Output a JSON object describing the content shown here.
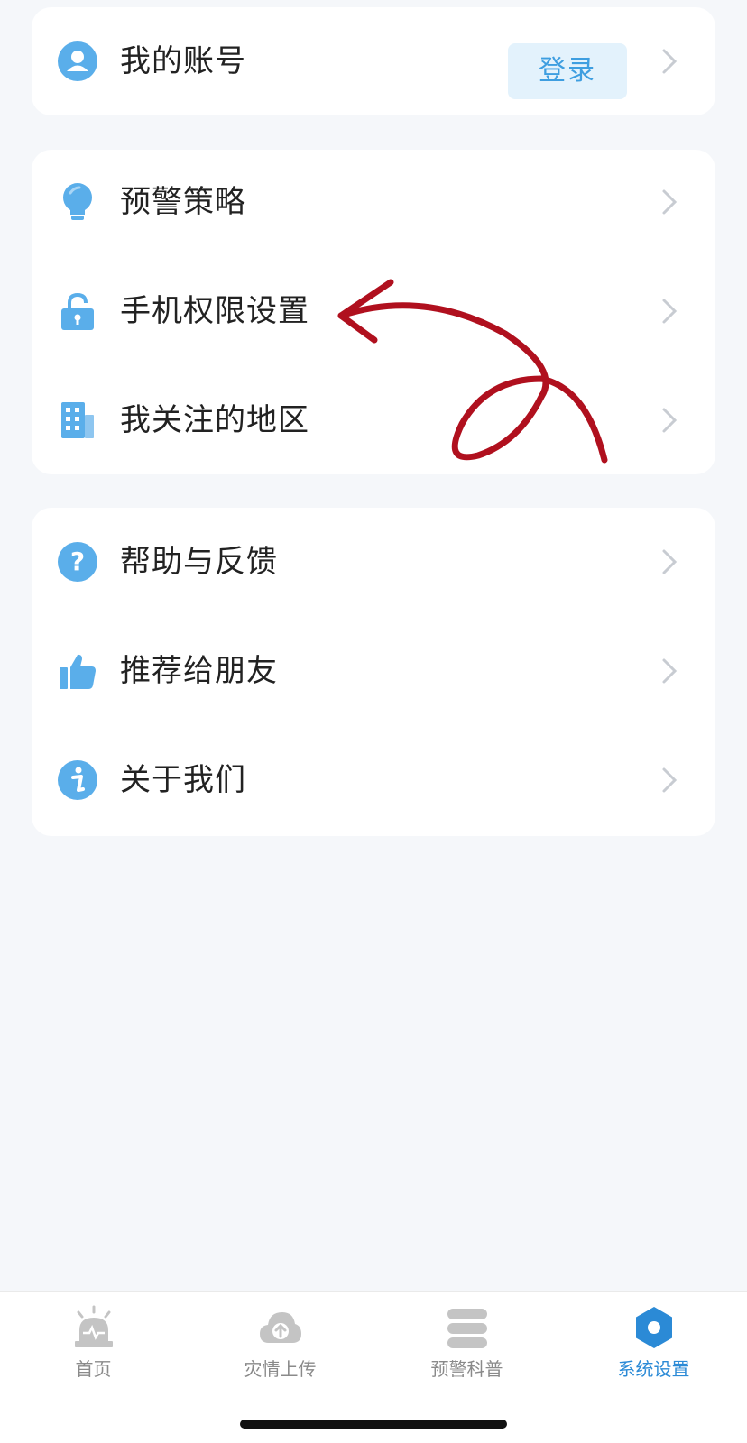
{
  "account_card": {
    "account_label": "我的账号",
    "login_button": "登录"
  },
  "settings_card": {
    "items": [
      {
        "label": "预警策略",
        "icon": "lightbulb-icon"
      },
      {
        "label": "手机权限设置",
        "icon": "lock-icon"
      },
      {
        "label": "我关注的地区",
        "icon": "building-icon"
      }
    ]
  },
  "support_card": {
    "items": [
      {
        "label": "帮助与反馈",
        "icon": "help-icon"
      },
      {
        "label": "推荐给朋友",
        "icon": "thumbs-up-icon"
      },
      {
        "label": "关于我们",
        "icon": "info-icon"
      }
    ]
  },
  "tabbar": {
    "tabs": [
      {
        "label": "首页",
        "icon": "alarm-light-icon",
        "active": false
      },
      {
        "label": "灾情上传",
        "icon": "cloud-upload-icon",
        "active": false
      },
      {
        "label": "预警科普",
        "icon": "book-stack-icon",
        "active": false
      },
      {
        "label": "系统设置",
        "icon": "settings-hexagon-icon",
        "active": true
      }
    ]
  },
  "colors": {
    "accent": "#2b8ad6",
    "icon_blue": "#5aaeea",
    "login_bg": "#e3f2fc",
    "annotation_red": "#b0101e",
    "inactive_tab": "#c4c4c4"
  }
}
